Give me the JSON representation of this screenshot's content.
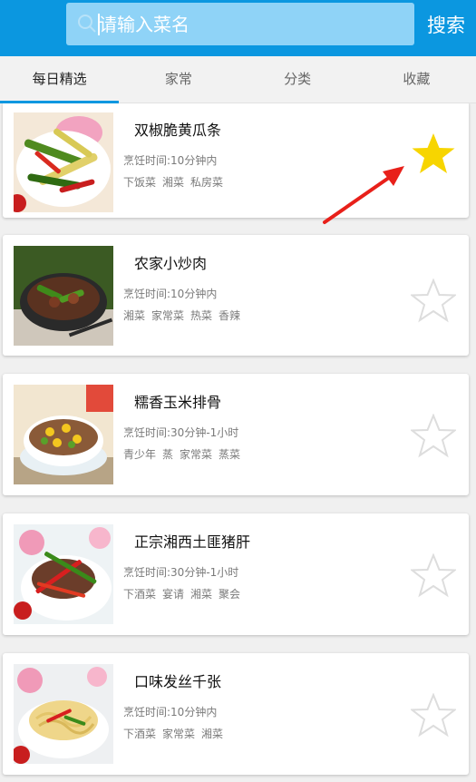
{
  "search": {
    "placeholder": "请输入菜名",
    "button_label": "搜索"
  },
  "tabs": [
    {
      "label": "每日精选",
      "active": true
    },
    {
      "label": "家常",
      "active": false
    },
    {
      "label": "分类",
      "active": false
    },
    {
      "label": "收藏",
      "active": false
    }
  ],
  "recipes": [
    {
      "title": "双椒脆黄瓜条",
      "time": "烹饪时间:10分钟内",
      "tags": [
        "下饭菜",
        "湘菜",
        "私房菜"
      ],
      "favorited": true
    },
    {
      "title": "农家小炒肉",
      "time": "烹饪时间:10分钟内",
      "tags": [
        "湘菜",
        "家常菜",
        "热菜",
        "香辣"
      ],
      "favorited": false
    },
    {
      "title": "糯香玉米排骨",
      "time": "烹饪时间:30分钟-1小时",
      "tags": [
        "青少年",
        "蒸",
        "家常菜",
        "蒸菜"
      ],
      "favorited": false
    },
    {
      "title": "正宗湘西土匪猪肝",
      "time": "烹饪时间:30分钟-1小时",
      "tags": [
        "下酒菜",
        "宴请",
        "湘菜",
        "聚会"
      ],
      "favorited": false
    },
    {
      "title": "口味发丝千张",
      "time": "烹饪时间:10分钟内",
      "tags": [
        "下酒菜",
        "家常菜",
        "湘菜"
      ],
      "favorited": false
    }
  ],
  "colors": {
    "brand": "#0b97e0",
    "star_active": "#f7d500",
    "star_inactive": "#dddddd",
    "arrow": "#e8201a"
  }
}
